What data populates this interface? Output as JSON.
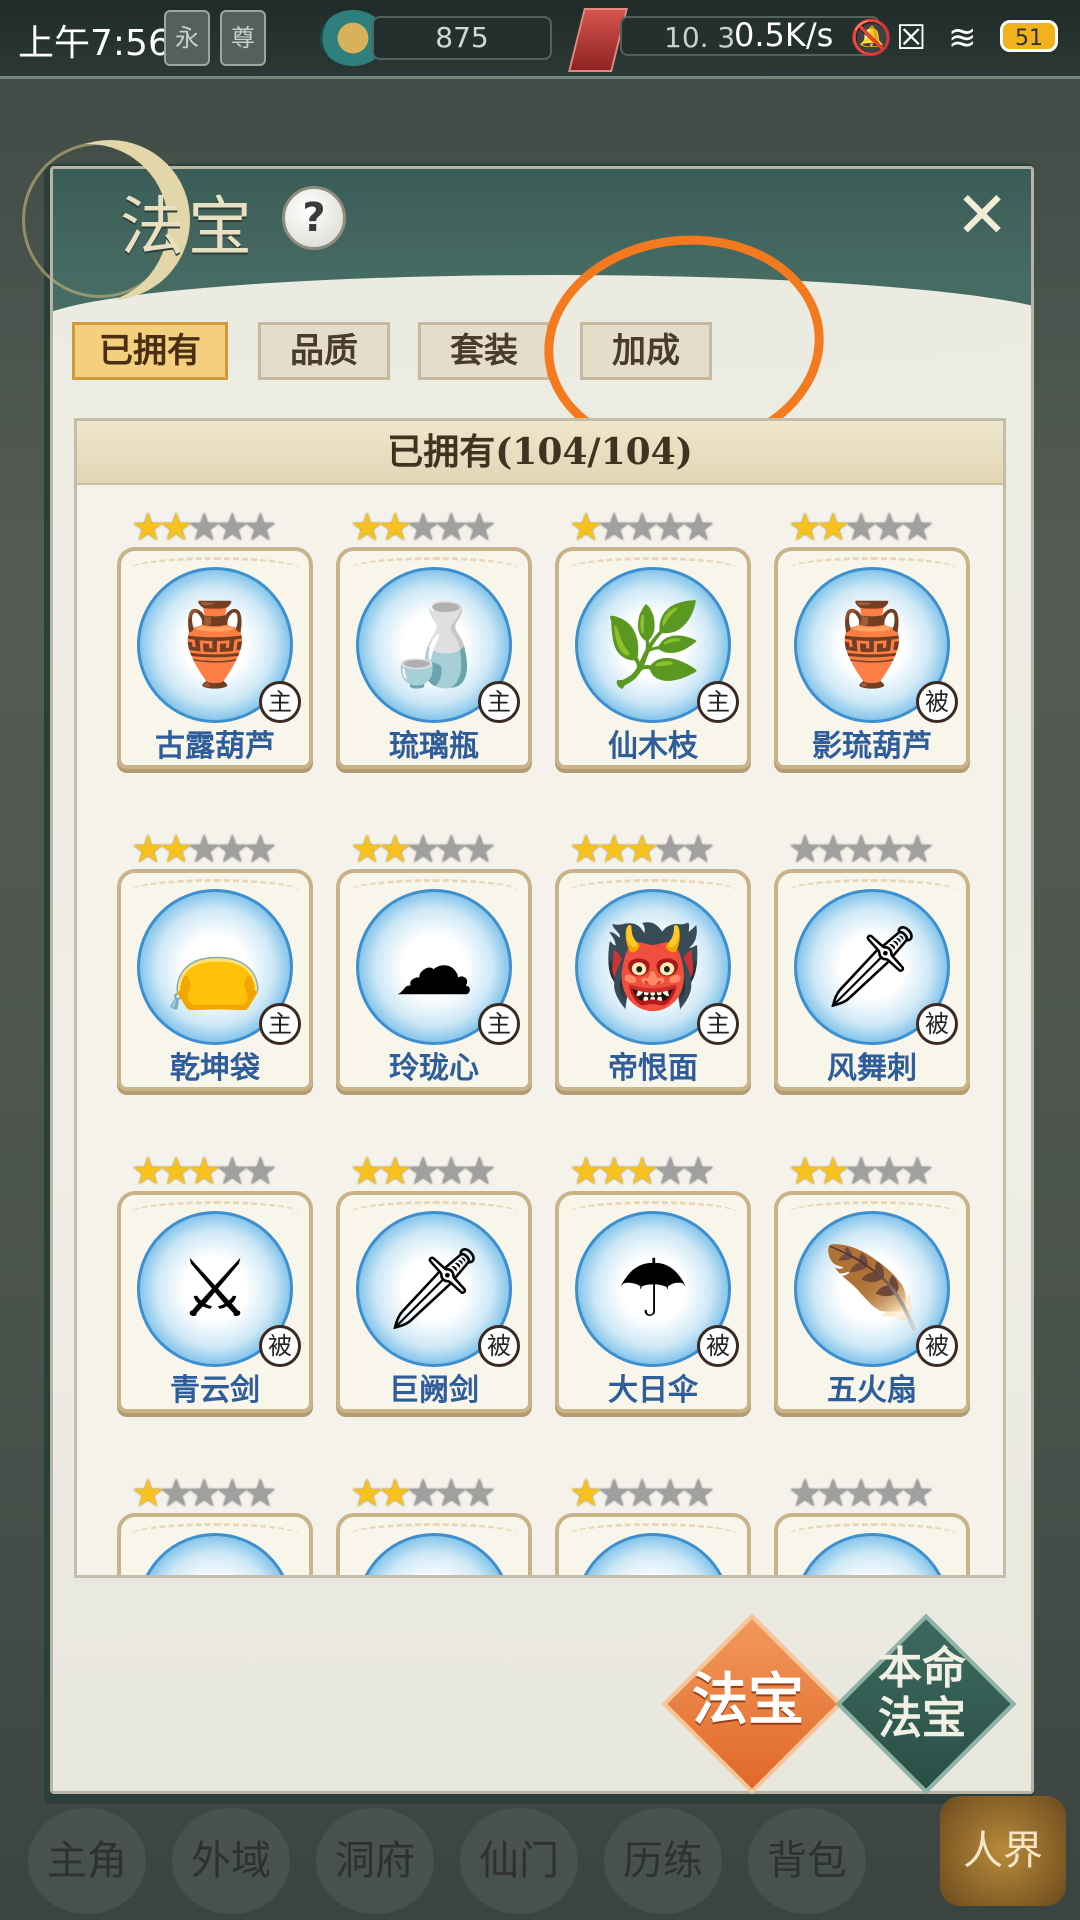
{
  "status_bar": {
    "time": "上午7:56",
    "runes": [
      "永",
      "尊"
    ],
    "currency1_value": "875",
    "currency2_value": "10. 3",
    "net_speed": "0.5K/s",
    "battery": "51"
  },
  "panel": {
    "title": "法宝",
    "help_label": "?",
    "close_label": "✕"
  },
  "tabs": [
    {
      "label": "已拥有",
      "active": true
    },
    {
      "label": "品质",
      "active": false
    },
    {
      "label": "套装",
      "active": false
    },
    {
      "label": "加成",
      "active": false
    }
  ],
  "list": {
    "header": "已拥有(104/104)",
    "items": [
      {
        "name": "古露葫芦",
        "stars": 2,
        "type": "主",
        "icon": "gourd-icon",
        "glyph": "🏺"
      },
      {
        "name": "琉璃瓶",
        "stars": 2,
        "type": "主",
        "icon": "vase-icon",
        "glyph": "🍶"
      },
      {
        "name": "仙木枝",
        "stars": 1,
        "type": "主",
        "icon": "branch-icon",
        "glyph": "🌿"
      },
      {
        "name": "影琉葫芦",
        "stars": 2,
        "type": "被",
        "icon": "teal-gourd-icon",
        "glyph": "🏺"
      },
      {
        "name": "乾坤袋",
        "stars": 2,
        "type": "主",
        "icon": "bag-icon",
        "glyph": "👝"
      },
      {
        "name": "玲珑心",
        "stars": 2,
        "type": "主",
        "icon": "cloud-icon",
        "glyph": "☁"
      },
      {
        "name": "帝恨面",
        "stars": 3,
        "type": "主",
        "icon": "mask-icon",
        "glyph": "👹"
      },
      {
        "name": "风舞刺",
        "stars": 0,
        "type": "被",
        "icon": "dagger-icon",
        "glyph": "🗡"
      },
      {
        "name": "青云剑",
        "stars": 3,
        "type": "被",
        "icon": "sword-icon",
        "glyph": "⚔"
      },
      {
        "name": "巨阙剑",
        "stars": 2,
        "type": "被",
        "icon": "broadsword-icon",
        "glyph": "🗡"
      },
      {
        "name": "大日伞",
        "stars": 3,
        "type": "被",
        "icon": "umbrella-icon",
        "glyph": "☂"
      },
      {
        "name": "五火扇",
        "stars": 2,
        "type": "被",
        "icon": "fan-icon",
        "glyph": "🪶"
      },
      {
        "name": "",
        "stars": 1,
        "type": "",
        "icon": "item-icon",
        "glyph": ""
      },
      {
        "name": "",
        "stars": 2,
        "type": "",
        "icon": "item-icon",
        "glyph": ""
      },
      {
        "name": "",
        "stars": 1,
        "type": "",
        "icon": "item-icon",
        "glyph": ""
      },
      {
        "name": "",
        "stars": 0,
        "type": "",
        "icon": "item-icon",
        "glyph": ""
      }
    ]
  },
  "buttons": {
    "fabao": "法宝",
    "benming_line1": "本命",
    "benming_line2": "法宝"
  },
  "bottom_nav": [
    "主角",
    "外域",
    "洞府",
    "仙门",
    "历练",
    "背包"
  ],
  "realm_button": "人界",
  "colors": {
    "accent_orange": "#f47a1f",
    "tab_active": "#f3cf7e",
    "item_name": "#2f5d9a",
    "header_green": "#3a5c56"
  }
}
